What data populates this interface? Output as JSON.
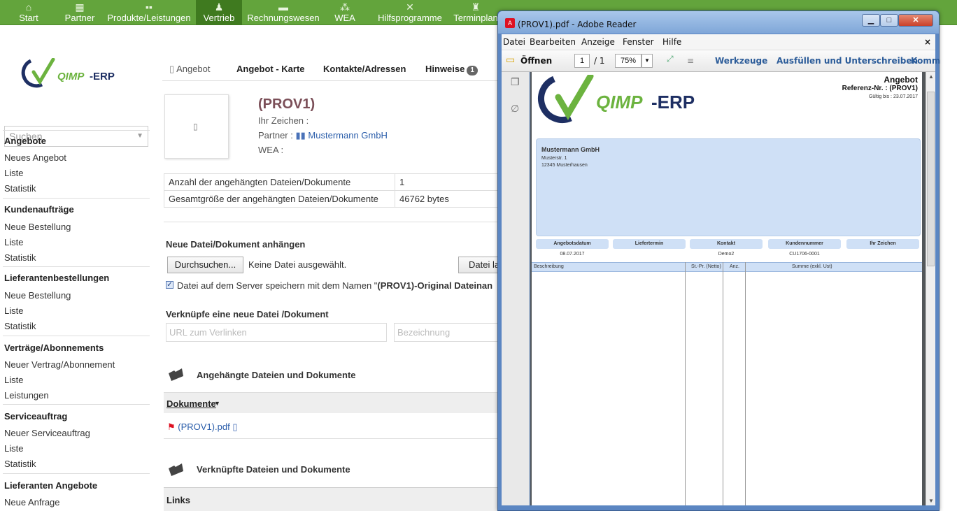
{
  "topnav": {
    "items": [
      {
        "label": "Start",
        "icon": "home-icon"
      },
      {
        "label": "Partner",
        "icon": "partner-icon"
      },
      {
        "label": "Produkte/Leistungen",
        "icon": "products-icon"
      },
      {
        "label": "Vertrieb",
        "icon": "sales-icon"
      },
      {
        "label": "Rechnungswesen",
        "icon": "accounting-icon"
      },
      {
        "label": "WEA",
        "icon": "wea-icon"
      },
      {
        "label": "Hilfsprogramme",
        "icon": "tools-icon"
      },
      {
        "label": "Terminplan",
        "icon": "schedule-icon"
      }
    ],
    "active": "Vertrieb",
    "color": "#63a43c"
  },
  "sidebar": {
    "logo": {
      "brand_q": "Q",
      "brand_name": "QIMP",
      "brand_suffix": "-ERP"
    },
    "search_placeholder": "Suchen",
    "sections": [
      {
        "title": "Angebote",
        "items": [
          "Neues Angebot",
          "Liste",
          "Statistik"
        ]
      },
      {
        "title": "Kundenaufträge",
        "items": [
          "Neue Bestellung",
          "Liste",
          "Statistik"
        ]
      },
      {
        "title": "Lieferantenbestellungen",
        "items": [
          "Neue Bestellung",
          "Liste",
          "Statistik"
        ]
      },
      {
        "title": "Verträge/Abonnements",
        "items": [
          "Neuer Vertrag/Abonnement",
          "Liste",
          "Leistungen"
        ]
      },
      {
        "title": "Serviceauftrag",
        "items": [
          "Neuer Serviceauftrag",
          "Liste",
          "Statistik"
        ]
      },
      {
        "title": "Lieferanten Angebote",
        "items": [
          "Neue Anfrage"
        ]
      }
    ]
  },
  "main": {
    "tabs": [
      {
        "label": "Angebot"
      },
      {
        "label": "Angebot - Karte"
      },
      {
        "label": "Kontakte/Adressen"
      },
      {
        "label": "Hinweise",
        "badge": "1"
      }
    ],
    "doc_title": "(PROV1)",
    "ihr_zeichen": "Ihr Zeichen :",
    "partner_label": "Partner :",
    "partner_name": "Mustermann GmbH",
    "wea": "WEA :",
    "info_rows": [
      {
        "label": "Anzahl der angehängten Dateien/Dokumente",
        "value": "1"
      },
      {
        "label": "Gesamtgröße der angehängten Dateien/Dokumente",
        "value": "46762 bytes"
      }
    ],
    "new_file_heading": "Neue Datei/Dokument anhängen",
    "browse_label": "Durchsuchen...",
    "no_file": "Keine Datei ausgewählt.",
    "upload_label": "Datei la",
    "save_checkbox_label": "Datei auf dem Server speichern mit dem Namen \"",
    "save_checkbox_name": "(PROV1)-Original Dateinan",
    "link_heading": "Verknüpfe eine neue Datei /Dokument",
    "url_placeholder": "URL zum Verlinken",
    "name_placeholder": "Bezeichnung",
    "attached_heading": "Angehängte Dateien und Dokumente",
    "docs_header": "Dokumente",
    "pdf_file": "(PROV1).pdf",
    "linked_heading": "Verknüpfte Dateien und Dokumente",
    "links_header": "Links"
  },
  "reader": {
    "title": "(PROV1).pdf - Adobe Reader",
    "menu": [
      "Datei",
      "Bearbeiten",
      "Anzeige",
      "Fenster",
      "Hilfe"
    ],
    "close_x": "×",
    "toolbar": {
      "open": "Öffnen",
      "page": "1",
      "page_total": "/ 1",
      "zoom": "75%",
      "tools": "Werkzeuge",
      "fill_sign": "Ausfüllen und Unterschreiben",
      "comment": "Komm"
    },
    "pdf": {
      "logo_name": "QIMP",
      "logo_suffix": "-ERP",
      "doc_type": "Angebot",
      "ref": "Referenz-Nr. : (PROV1)",
      "valid": "Gültig bis : 23.07.2017",
      "company": "Mustermann GmbH",
      "street": "Musterstr. 1",
      "city": "12345 Musterhausen",
      "columns": [
        "Angebotsdatum",
        "Liefertermin",
        "Kontakt",
        "Kundennummer",
        "Ihr Zeichen"
      ],
      "values": [
        "08.07.2017",
        "",
        "Demo2",
        "CU1706-0001",
        ""
      ],
      "table_heads": [
        "Beschreibung",
        "St.-Pr. (Netto)",
        "Anz.",
        "Summe (exkl. Ust)"
      ]
    }
  }
}
